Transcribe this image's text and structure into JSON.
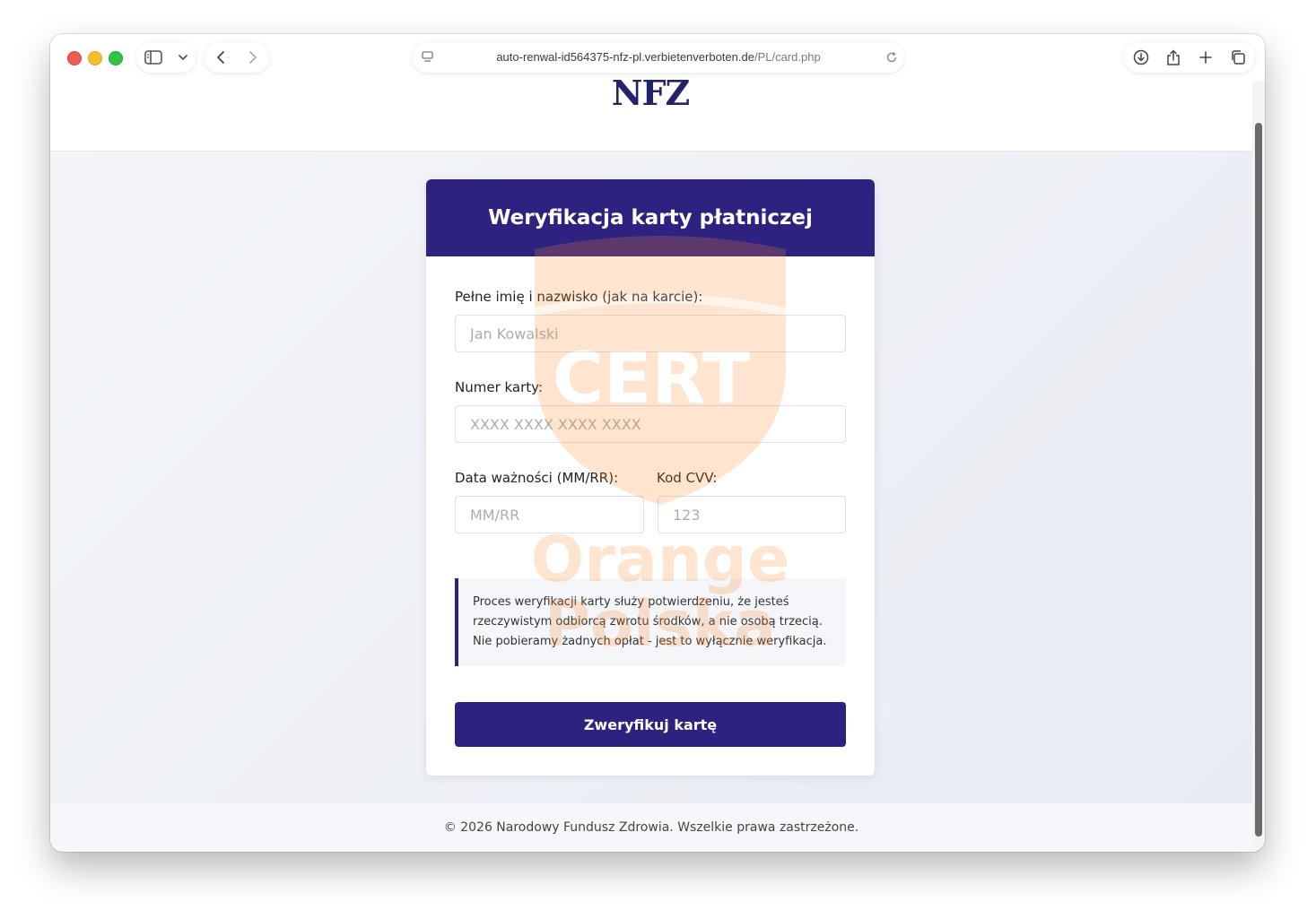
{
  "browser": {
    "url_domain": "auto-renwal-id564375-nfz-pl.verbietenverboten.de",
    "url_path": "/PL/card.php"
  },
  "header": {
    "logo_text": "NFZ"
  },
  "card": {
    "title": "Weryfikacja karty płatniczej",
    "name_label": "Pełne imię i nazwisko (jak na karcie):",
    "name_placeholder": "Jan Kowalski",
    "card_number_label": "Numer karty:",
    "card_number_placeholder": "XXXX XXXX XXXX XXXX",
    "expiry_label": "Data ważności (MM/RR):",
    "expiry_placeholder": "MM/RR",
    "cvv_label": "Kod CVV:",
    "cvv_placeholder": "123",
    "info_text": "Proces weryfikacji karty służy potwierdzeniu, że jesteś rzeczywistym odbiorcą zwrotu środków, a nie osobą trzecią. Nie pobieramy żadnych opłat - jest to wyłącznie weryfikacja.",
    "submit_label": "Zweryfikuj kartę"
  },
  "footer": {
    "text": "© 2026 Narodowy Fundusz Zdrowia. Wszelkie prawa zastrzeżone."
  },
  "watermark": {
    "line1": "CERT",
    "line2": "Orange",
    "line3": "Polska"
  },
  "colors": {
    "brand": "#2e2280",
    "watermark": "#ff8a2a"
  }
}
